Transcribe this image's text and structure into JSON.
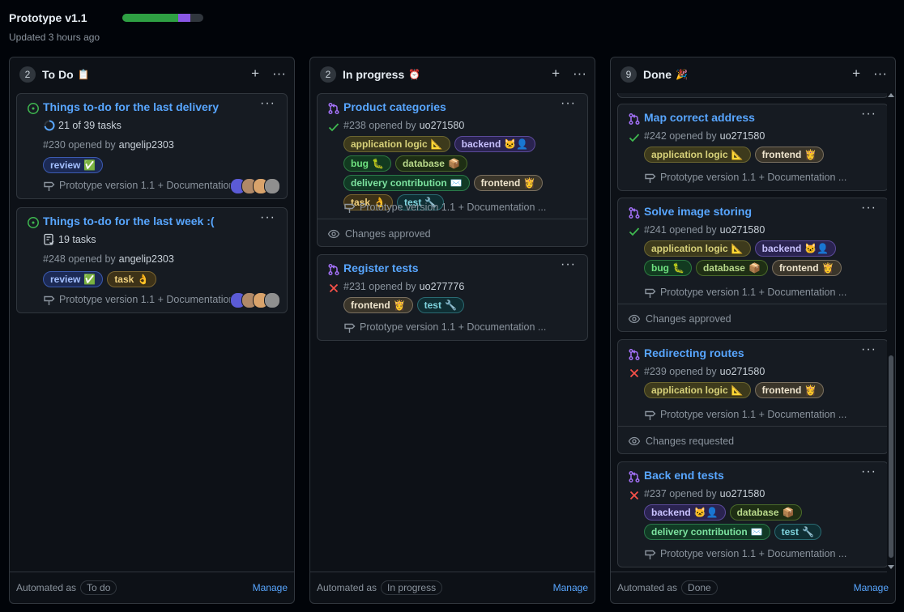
{
  "header": {
    "title": "Prototype v1.1",
    "updated": "Updated 3 hours ago"
  },
  "progress": {
    "done_fraction": 0.69,
    "in_progress_fraction": 0.15,
    "color_done": "#2ea043",
    "color_progress": "#8957e5"
  },
  "label_colors": {
    "application logic": {
      "bg": "#3d3a1c",
      "border": "#6b6530",
      "fg": "#d8d27a"
    },
    "backend": {
      "bg": "#2a2350",
      "border": "#5b4a9a",
      "fg": "#c9c2ff"
    },
    "bug": {
      "bg": "#123a20",
      "border": "#2c7a40",
      "fg": "#6ee07f"
    },
    "database": {
      "bg": "#1e2e14",
      "border": "#4a6a2a",
      "fg": "#b8d88a"
    },
    "delivery contribution": {
      "bg": "#113a25",
      "border": "#2a7a4a",
      "fg": "#7de3a0"
    },
    "frontend": {
      "bg": "#3a352a",
      "border": "#7a7060",
      "fg": "#f0e6cf"
    },
    "task": {
      "bg": "#3d3218",
      "border": "#7a6430",
      "fg": "#f2d27e"
    },
    "test": {
      "bg": "#0f2e33",
      "border": "#2a6a72",
      "fg": "#7fd4de"
    },
    "review": {
      "bg": "#1c2a55",
      "border": "#3b5ab0",
      "fg": "#a4c0ff"
    }
  },
  "columns": [
    {
      "count": "2",
      "name": "To Do",
      "emoji": "📋",
      "footer": {
        "automated": "Automated as",
        "state": "To do",
        "manage": "Manage"
      },
      "cards": [
        {
          "kind": "issue",
          "title": "Things to-do for the last delivery",
          "tasks_icon": "progress-ring-icon",
          "tasks": "21 of 39 tasks",
          "opened": "#230 opened by",
          "user": "angelip2303",
          "labels": [
            {
              "text": "review",
              "emoji": "✅"
            }
          ],
          "milestone": "Prototype version 1.1 + Documentation",
          "avatars": 4
        },
        {
          "kind": "issue",
          "title": "Things to-do for the last week :(",
          "tasks_icon": "checklist-icon",
          "tasks": "19 tasks",
          "opened": "#248 opened by",
          "user": "angelip2303",
          "labels": [
            {
              "text": "review",
              "emoji": "✅"
            },
            {
              "text": "task",
              "emoji": "👌"
            }
          ],
          "milestone": "Prototype version 1.1 + Documentation",
          "avatars": 4
        }
      ]
    },
    {
      "count": "2",
      "name": "In progress",
      "emoji": "⏰",
      "footer": {
        "automated": "Automated as",
        "state": "In progress",
        "manage": "Manage"
      },
      "cards": [
        {
          "kind": "pr",
          "title": "Product categories",
          "status": "check",
          "opened": "#238 opened by",
          "user": "uo271580",
          "labels": [
            {
              "text": "application logic",
              "emoji": "📐"
            },
            {
              "text": "backend",
              "emoji": "🐱‍👤"
            },
            {
              "text": "bug",
              "emoji": "🐛"
            },
            {
              "text": "database",
              "emoji": "📦"
            },
            {
              "text": "delivery contribution",
              "emoji": "✉️"
            },
            {
              "text": "frontend",
              "emoji": "👸"
            },
            {
              "text": "task",
              "emoji": "👌"
            },
            {
              "text": "test",
              "emoji": "🔧"
            }
          ],
          "milestone": "Prototype version 1.1 + Documentation ...",
          "note": "Changes approved"
        },
        {
          "kind": "pr",
          "title": "Register tests",
          "status": "x",
          "opened": "#231 opened by",
          "user": "uo277776",
          "labels": [
            {
              "text": "frontend",
              "emoji": "👸"
            },
            {
              "text": "test",
              "emoji": "🔧"
            }
          ],
          "milestone": "Prototype version 1.1 + Documentation ..."
        }
      ]
    },
    {
      "count": "9",
      "name": "Done",
      "emoji": "🎉",
      "footer": {
        "automated": "Automated as",
        "state": "Done",
        "manage": "Manage"
      },
      "cards": [
        {
          "kind": "pr",
          "title": "Map correct address",
          "status": "check",
          "opened": "#242 opened by",
          "user": "uo271580",
          "labels": [
            {
              "text": "application logic",
              "emoji": "📐"
            },
            {
              "text": "frontend",
              "emoji": "👸"
            }
          ],
          "milestone": "Prototype version 1.1 + Documentation ..."
        },
        {
          "kind": "pr",
          "title": "Solve image storing",
          "status": "check",
          "opened": "#241 opened by",
          "user": "uo271580",
          "labels": [
            {
              "text": "application logic",
              "emoji": "📐"
            },
            {
              "text": "backend",
              "emoji": "🐱‍👤"
            },
            {
              "text": "bug",
              "emoji": "🐛"
            },
            {
              "text": "database",
              "emoji": "📦"
            },
            {
              "text": "frontend",
              "emoji": "👸"
            }
          ],
          "milestone": "Prototype version 1.1 + Documentation ...",
          "note": "Changes approved"
        },
        {
          "kind": "pr",
          "title": "Redirecting routes",
          "status": "x",
          "opened": "#239 opened by",
          "user": "uo271580",
          "labels": [
            {
              "text": "application logic",
              "emoji": "📐"
            },
            {
              "text": "frontend",
              "emoji": "👸"
            }
          ],
          "milestone": "Prototype version 1.1 + Documentation ...",
          "note": "Changes requested"
        },
        {
          "kind": "pr",
          "title": "Back end tests",
          "status": "x",
          "opened": "#237 opened by",
          "user": "uo271580",
          "labels": [
            {
              "text": "backend",
              "emoji": "🐱‍👤"
            },
            {
              "text": "database",
              "emoji": "📦"
            },
            {
              "text": "delivery contribution",
              "emoji": "✉️"
            },
            {
              "text": "test",
              "emoji": "🔧"
            }
          ],
          "milestone": "Prototype version 1.1 + Documentation ..."
        }
      ]
    }
  ]
}
